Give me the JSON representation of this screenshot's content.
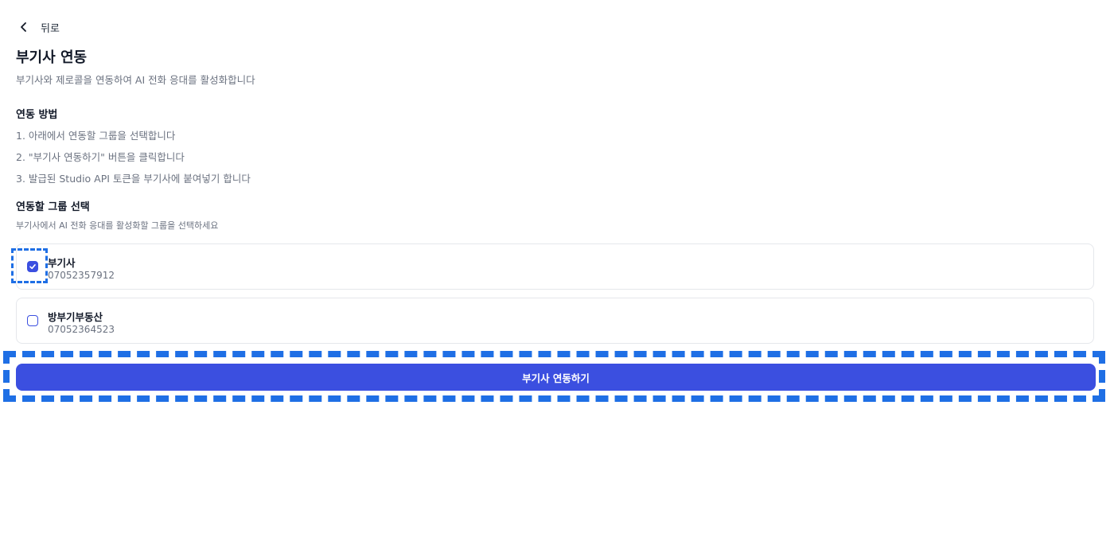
{
  "header": {
    "back_label": "뒤로",
    "title": "부기사 연동",
    "subtitle": "부기사와 제로콜을 연동하여 AI 전화 응대를 활성화합니다"
  },
  "method": {
    "title": "연동 방법",
    "steps": [
      "1. 아래에서 연동할 그룹을 선택합니다",
      "2. \"부기사 연동하기\" 버튼을 클릭합니다",
      "3. 발급된 Studio API 토큰을 부기사에 붙여넣기 합니다"
    ]
  },
  "group_select": {
    "title": "연동할 그룹 선택",
    "hint": "부기사에서 AI 전화 응대를 활성화할 그룹을 선택하세요",
    "groups": [
      {
        "name": "부기사",
        "phone": "07052357912",
        "checked": true
      },
      {
        "name": "방부기부동산",
        "phone": "07052364523",
        "checked": false
      }
    ]
  },
  "actions": {
    "connect_label": "부기사 연동하기"
  },
  "colors": {
    "accent": "#3b4fe0",
    "focus": "#1f6fe5",
    "muted_text": "#6b7280",
    "border": "#e5e7eb"
  }
}
